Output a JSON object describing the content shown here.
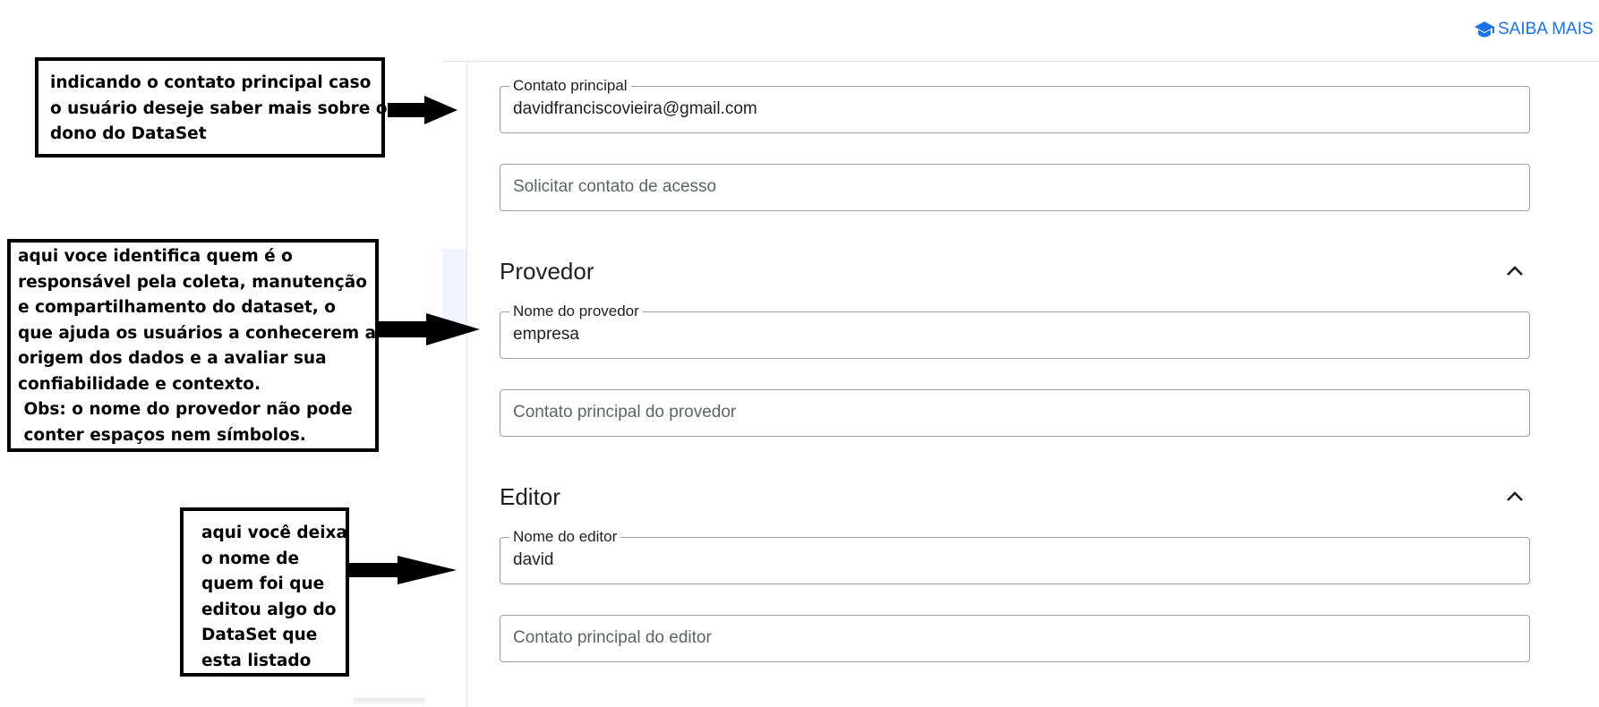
{
  "header": {
    "learn_more_label": "SAIBA MAIS",
    "learn_more_icon": "graduation-cap-icon",
    "accent_color": "#1a73e8"
  },
  "contact": {
    "main_contact_label": "Contato principal",
    "main_contact_value": "davidfranciscovieira@gmail.com",
    "access_contact_placeholder": "Solicitar contato de acesso"
  },
  "provider": {
    "title": "Provedor",
    "name_label": "Nome do provedor",
    "name_value": "empresa",
    "contact_placeholder": "Contato principal do provedor"
  },
  "editor": {
    "title": "Editor",
    "name_label": "Nome do editor",
    "name_value": "david",
    "contact_placeholder": "Contato principal do editor"
  },
  "annotations": {
    "contact_note": [
      "indicando o contato principal caso",
      "o usuário deseje saber mais sobre o",
      "dono do DataSet"
    ],
    "provider_note": [
      "aqui voce identifica quem é o",
      "responsável pela coleta, manutenção",
      "e compartilhamento do dataset, o",
      "que ajuda os usuários a conhecerem a",
      "origem dos dados e a avaliar sua",
      "confiabilidade e contexto.",
      " Obs: o nome do provedor não pode",
      " conter espaços nem símbolos."
    ],
    "editor_note": [
      "aqui você deixa",
      "o nome de",
      "quem foi que",
      "editou algo do",
      "DataSet que",
      "esta listado"
    ]
  }
}
